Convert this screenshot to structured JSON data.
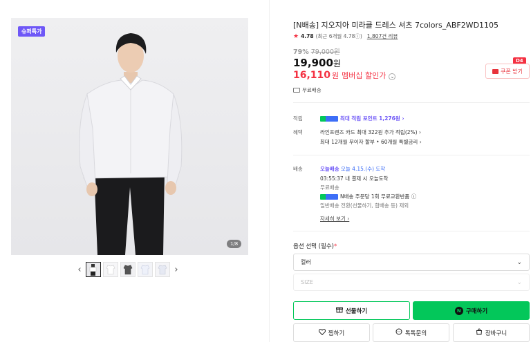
{
  "gallery": {
    "badge": "슈퍼특가",
    "page_count": "1/8",
    "prev": "‹",
    "next": "›"
  },
  "product": {
    "title": "[N배송] 지오지아 미라클 드레스 셔츠 7colors_ABF2WD1105",
    "rating": "4.78",
    "rating_sub": "(최근 6개월 4.78ⓘ)",
    "reviews": "1,807건 리뷰",
    "discount": "79%",
    "original_price": "79,000원",
    "price": "19,900",
    "price_unit": "원",
    "member_price": "16,110",
    "member_unit": "원",
    "member_label": "멤버십 할인가",
    "coupon_label": "쿠폰 받기",
    "coupon_badge": "D4",
    "free_shipping": "무료배송"
  },
  "benefits": {
    "points_label": "적립",
    "points_value": "최대 적립 포인트 1,276원 ›",
    "perks_label": "혜택",
    "perk1": "라인프렌즈 카드 최대 322원 추가 적립(2%) ›",
    "perk2": "최대 12개월 무이자 할부 • 60개월 특별금리 ›"
  },
  "delivery": {
    "label": "배송",
    "today_tag": "오늘배송",
    "arrival": "오늘 4.15.(수) 도착",
    "cutoff": "03:55:37  내 결제 시 오늘도착",
    "free": "무료배송",
    "exchange": "N배송 주문당 1회 무료교환반품 ⓘ",
    "note": "일반배송 전환(선물하기, 합배송 등) 제외",
    "detail_link": "자세히 보기 ›"
  },
  "options": {
    "title": "옵션 선택 (필수)",
    "required_mark": "*",
    "color_select": "컬러",
    "size_select": "SIZE",
    "chevron": "⌄"
  },
  "actions": {
    "gift": "선물하기",
    "buy": "구매하기",
    "wish": "찜하기",
    "talk": "톡톡문의",
    "cart": "장바구니"
  },
  "colors": {
    "accent_green": "#03c75a",
    "accent_red": "#f43142",
    "accent_purple": "#6e57f7"
  }
}
